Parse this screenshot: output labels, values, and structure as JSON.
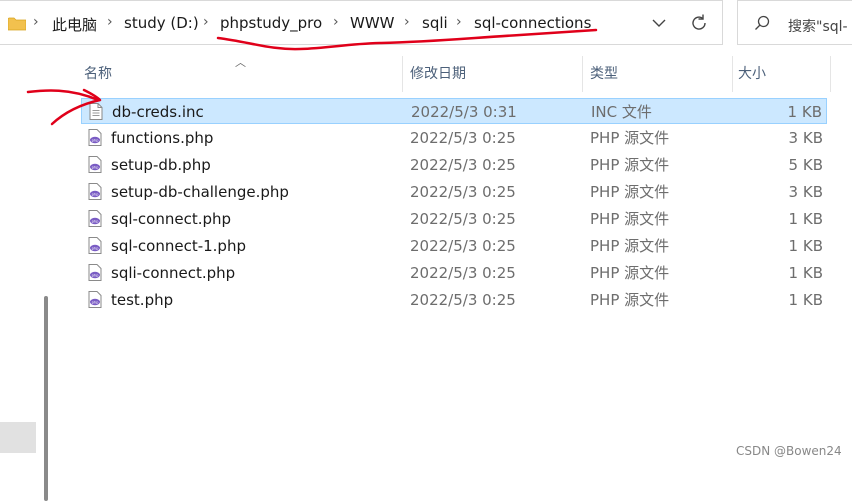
{
  "breadcrumb": {
    "items": [
      "此电脑",
      "study (D:)",
      "phpstudy_pro",
      "WWW",
      "sqli",
      "sql-connections"
    ]
  },
  "search": {
    "placeholder": "搜索\"sql-"
  },
  "columns": {
    "name": "名称",
    "modified": "修改日期",
    "type": "类型",
    "size": "大小"
  },
  "files": [
    {
      "name": "db-creds.inc",
      "modified": "2022/5/3 0:31",
      "type": "INC 文件",
      "size": "1 KB",
      "icon": "generic-file-icon",
      "selected": true
    },
    {
      "name": "functions.php",
      "modified": "2022/5/3 0:25",
      "type": "PHP 源文件",
      "size": "3 KB",
      "icon": "php-file-icon"
    },
    {
      "name": "setup-db.php",
      "modified": "2022/5/3 0:25",
      "type": "PHP 源文件",
      "size": "5 KB",
      "icon": "php-file-icon"
    },
    {
      "name": "setup-db-challenge.php",
      "modified": "2022/5/3 0:25",
      "type": "PHP 源文件",
      "size": "3 KB",
      "icon": "php-file-icon"
    },
    {
      "name": "sql-connect.php",
      "modified": "2022/5/3 0:25",
      "type": "PHP 源文件",
      "size": "1 KB",
      "icon": "php-file-icon"
    },
    {
      "name": "sql-connect-1.php",
      "modified": "2022/5/3 0:25",
      "type": "PHP 源文件",
      "size": "1 KB",
      "icon": "php-file-icon"
    },
    {
      "name": "sqli-connect.php",
      "modified": "2022/5/3 0:25",
      "type": "PHP 源文件",
      "size": "1 KB",
      "icon": "php-file-icon"
    },
    {
      "name": "test.php",
      "modified": "2022/5/3 0:25",
      "type": "PHP 源文件",
      "size": "1 KB",
      "icon": "php-file-icon"
    }
  ],
  "watermark": "CSDN @Bowen24",
  "colors": {
    "selection": "#cce8ff",
    "selection_border": "#99d1ff",
    "annotation": "#e0001a",
    "folder": "#f2c14e",
    "php_icon": "#7a5cc4"
  }
}
